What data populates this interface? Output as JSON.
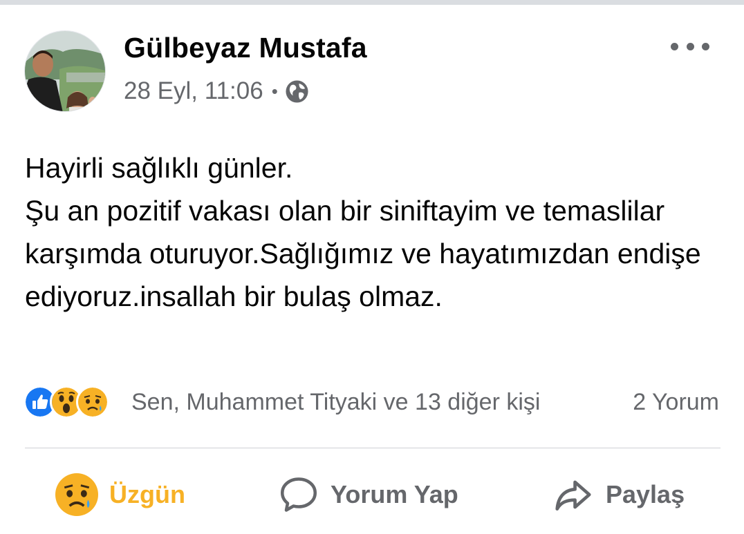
{
  "post": {
    "author": "Gülbeyaz Mustafa",
    "date": "28 Eyl, 11:06",
    "separator": "•",
    "privacy_icon": "globe-icon",
    "more_icon": "more-options-icon",
    "text": "Hayirli sağlıklı günler.\nŞu an pozitif vakası olan bir siniftayim ve temaslilar karşımda oturuyor.Sağlığımız ve hayatımızdan endişe ediyoruz.insallah bir bulaş olmaz."
  },
  "reactions": {
    "icons": [
      "like-reaction-icon",
      "wow-reaction-icon",
      "sad-reaction-icon"
    ],
    "summary": "Sen, Muhammet Tityaki ve 13 diğer kişi",
    "comments": "2 Yorum"
  },
  "actions": {
    "reaction_label": "Üzgün",
    "comment_label": "Yorum Yap",
    "share_label": "Paylaş"
  },
  "colors": {
    "sad_accent": "#f7b125",
    "secondary_text": "#65676b",
    "like_blue": "#1877f2"
  }
}
